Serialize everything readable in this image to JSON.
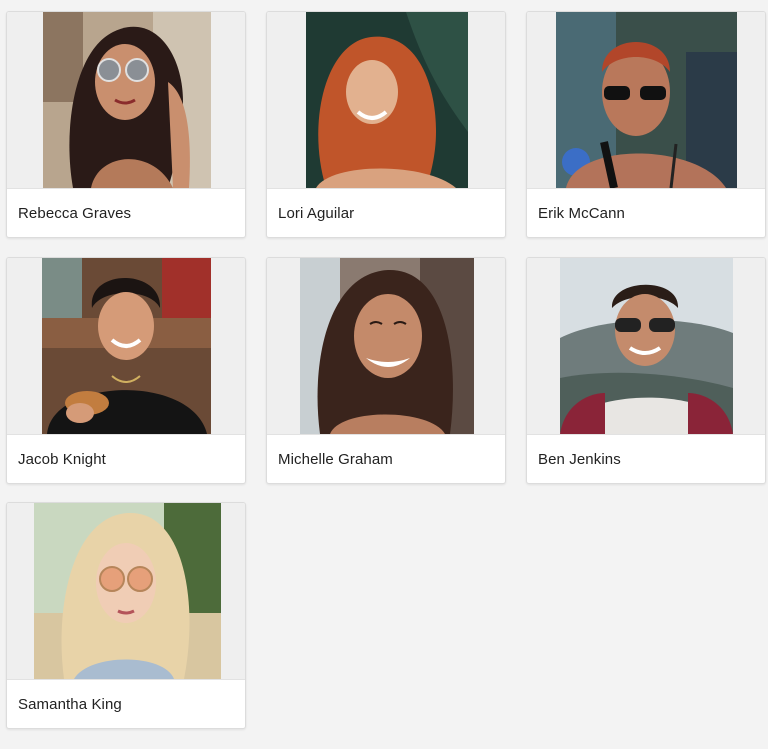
{
  "gallery": {
    "people": [
      {
        "name": "Rebecca Graves"
      },
      {
        "name": "Lori Aguilar"
      },
      {
        "name": "Erik McCann"
      },
      {
        "name": "Jacob Knight"
      },
      {
        "name": "Michelle Graham"
      },
      {
        "name": "Ben Jenkins"
      },
      {
        "name": "Samantha King"
      }
    ]
  }
}
